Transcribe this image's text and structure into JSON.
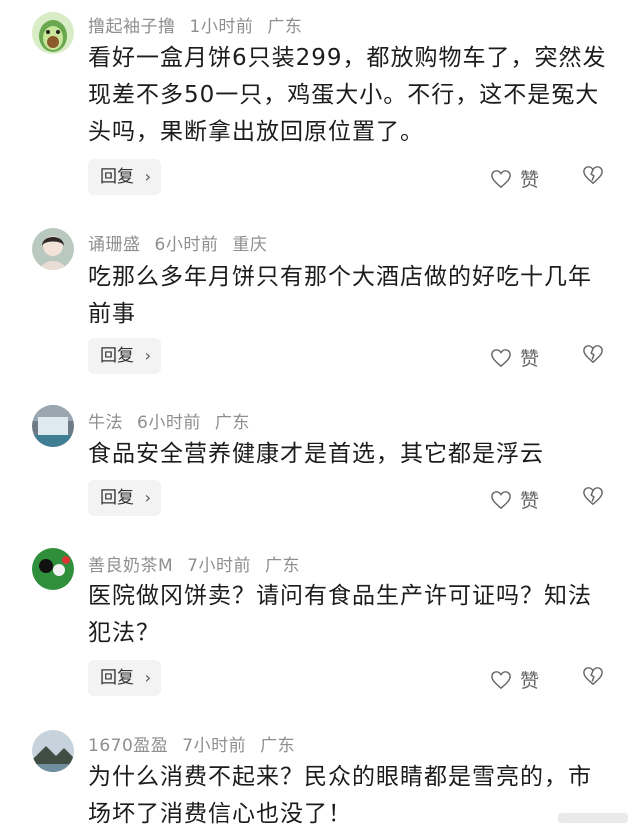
{
  "actions": {
    "reply_label": "回复",
    "like_label": "赞"
  },
  "comments": [
    {
      "user": "撸起袖子撸",
      "time": "1小时前",
      "location": "广东",
      "text": "看好一盒月饼6只装299，都放购物车了，突然发现差不多50一只，鸡蛋大小。不行，这不是冤大头吗，果断拿出放回原位置了。",
      "avatar": "avocado-avatar"
    },
    {
      "user": "诵珊盛",
      "time": "6小时前",
      "location": "重庆",
      "text": "吃那么多年月饼只有那个大酒店做的好吃十几年前事",
      "avatar": "portrait-avatar"
    },
    {
      "user": "牛法",
      "time": "6小时前",
      "location": "广东",
      "text": "食品安全营养健康才是首选，其它都是浮云",
      "avatar": "waterfall-avatar"
    },
    {
      "user": "善良奶茶M",
      "time": "7小时前",
      "location": "广东",
      "text": "医院做冈饼卖？请问有食品生产许可证吗？知法犯法？",
      "avatar": "billiards-avatar"
    },
    {
      "user": "1670盈盈",
      "time": "7小时前",
      "location": "广东",
      "text": "为什么消费不起来？民众的眼睛都是雪亮的，市场坏了消费信心也没了！",
      "avatar": "landscape-avatar"
    }
  ]
}
